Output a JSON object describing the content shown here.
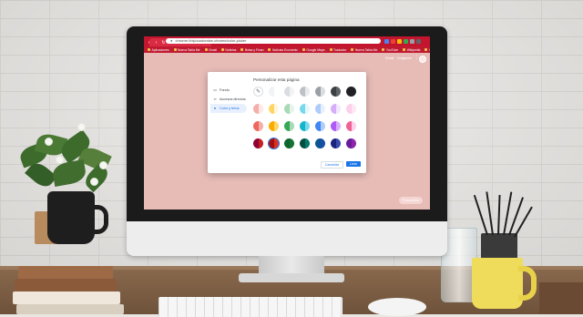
{
  "browser": {
    "url": "chrome://ntp/customize-chrome/color-picker",
    "bookmarks": [
      {
        "label": "Aplicaciones"
      },
      {
        "label": "Nueva Tabla Me"
      },
      {
        "label": "Gmail"
      },
      {
        "label": "Noticias"
      },
      {
        "label": "Bolsa y Finan"
      },
      {
        "label": "Noticias Económic"
      },
      {
        "label": "Google Maps"
      },
      {
        "label": "Traductor"
      },
      {
        "label": "Nueva Tabla Me"
      },
      {
        "label": "YouTube"
      },
      {
        "label": "Wikipedia"
      },
      {
        "label": "Ver todos"
      }
    ],
    "extension_colors": [
      "#4285f4",
      "#ea4335",
      "#fbbc05",
      "#34a853",
      "#9aa0a6",
      "#5f6368"
    ]
  },
  "ntp": {
    "top_links": [
      "Gmail",
      "Imágenes"
    ],
    "customize_chip": "Personalizar"
  },
  "dialog": {
    "title": "Personalizar esta página",
    "nav": [
      {
        "label": "Fondo",
        "icon": "image-icon",
        "active": false
      },
      {
        "label": "Accesos directos",
        "icon": "link-icon",
        "active": false
      },
      {
        "label": "Color y tema",
        "icon": "palette-icon",
        "active": true
      }
    ],
    "swatches": [
      {
        "left": "#ffffff",
        "right": "#ffffff",
        "kind": "custom"
      },
      {
        "left": "#f1f3f4",
        "right": "#ffffff"
      },
      {
        "left": "#dadce0",
        "right": "#f1f3f4"
      },
      {
        "left": "#bdc1c6",
        "right": "#e8eaed"
      },
      {
        "left": "#9aa0a6",
        "right": "#dadce0"
      },
      {
        "left": "#3c4043",
        "right": "#5f6368"
      },
      {
        "left": "#202124",
        "right": "#202124"
      },
      {
        "left": "#f6aea9",
        "right": "#fce8e6"
      },
      {
        "left": "#fdd663",
        "right": "#fef7e0"
      },
      {
        "left": "#a8dab5",
        "right": "#e6f4ea"
      },
      {
        "left": "#78d9ec",
        "right": "#e4f7fb"
      },
      {
        "left": "#aecbfa",
        "right": "#e8f0fe"
      },
      {
        "left": "#d7aefb",
        "right": "#f3e8fd"
      },
      {
        "left": "#fdcfe8",
        "right": "#fde7f3"
      },
      {
        "left": "#ee675c",
        "right": "#f6aea9"
      },
      {
        "left": "#f9ab00",
        "right": "#fdd663"
      },
      {
        "left": "#34a853",
        "right": "#a8dab5"
      },
      {
        "left": "#12b5cb",
        "right": "#78d9ec"
      },
      {
        "left": "#4285f4",
        "right": "#aecbfa"
      },
      {
        "left": "#af5cf7",
        "right": "#d7aefb"
      },
      {
        "left": "#f06292",
        "right": "#fdcfe8"
      },
      {
        "left": "#8e0038",
        "right": "#c5221f"
      },
      {
        "left": "#a50e0e",
        "right": "#d93025",
        "selected": true
      },
      {
        "left": "#0d652d",
        "right": "#137333"
      },
      {
        "left": "#004d40",
        "right": "#00796b"
      },
      {
        "left": "#0b5394",
        "right": "#174ea6"
      },
      {
        "left": "#1a237e",
        "right": "#3949ab"
      },
      {
        "left": "#6a1b9a",
        "right": "#8e24aa"
      }
    ],
    "cancel_label": "Cancelar",
    "done_label": "Listo"
  }
}
